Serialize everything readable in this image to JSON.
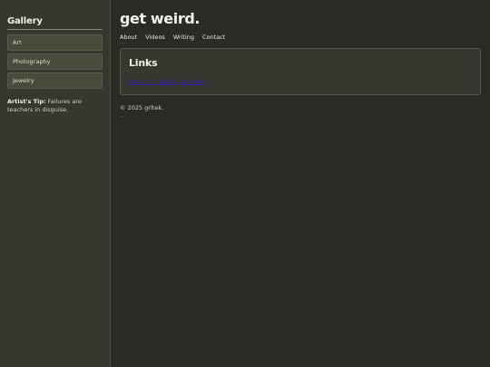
{
  "sidebar": {
    "title": "Gallery",
    "items": [
      {
        "label": "Art"
      },
      {
        "label": "Photography"
      },
      {
        "label": "Jewelry"
      }
    ],
    "tip_label": "Artist's Tip:",
    "tip_text": " Failures are teachers in disguise."
  },
  "header": {
    "title": "get weird.",
    "nav": [
      {
        "label": "About"
      },
      {
        "label": "Videos"
      },
      {
        "label": "Writing"
      },
      {
        "label": "Contact"
      }
    ],
    "nav_dots": "..."
  },
  "links_card": {
    "title": "Links",
    "links": [
      {
        "label": "Instagram"
      },
      {
        "label": "Twitter"
      },
      {
        "label": "Facebook"
      }
    ]
  },
  "footer": {
    "copyright": "© 2025 grltek.",
    "dots": "..."
  },
  "colors": {
    "background": "#2b2a27",
    "sidebar": "#373730",
    "link": "#2b1fb0"
  }
}
